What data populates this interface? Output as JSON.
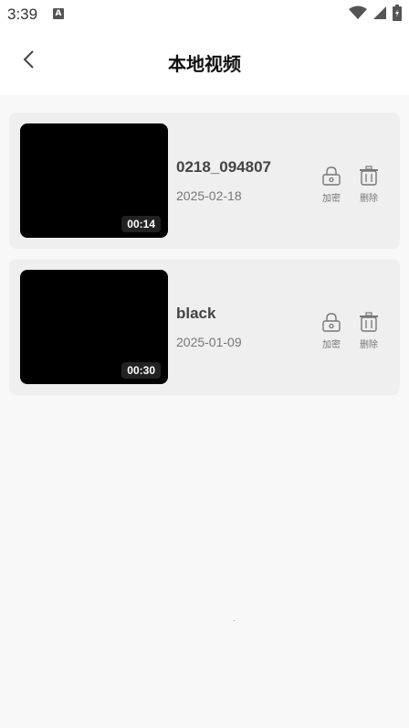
{
  "status_bar": {
    "time": "3:39",
    "notification_icon": "A"
  },
  "header": {
    "title": "本地视频",
    "back_icon": "chevron-left-icon"
  },
  "videos": [
    {
      "name": "0218_094807",
      "date": "2025-02-18",
      "duration": "00:14",
      "lock_label": "加密",
      "delete_label": "删除"
    },
    {
      "name": "black",
      "date": "2025-01-09",
      "duration": "00:30",
      "lock_label": "加密",
      "delete_label": "删除"
    }
  ],
  "colors": {
    "card_bg": "#efefef",
    "page_bg": "#f8f8f8",
    "thumb_bg": "#000000"
  }
}
